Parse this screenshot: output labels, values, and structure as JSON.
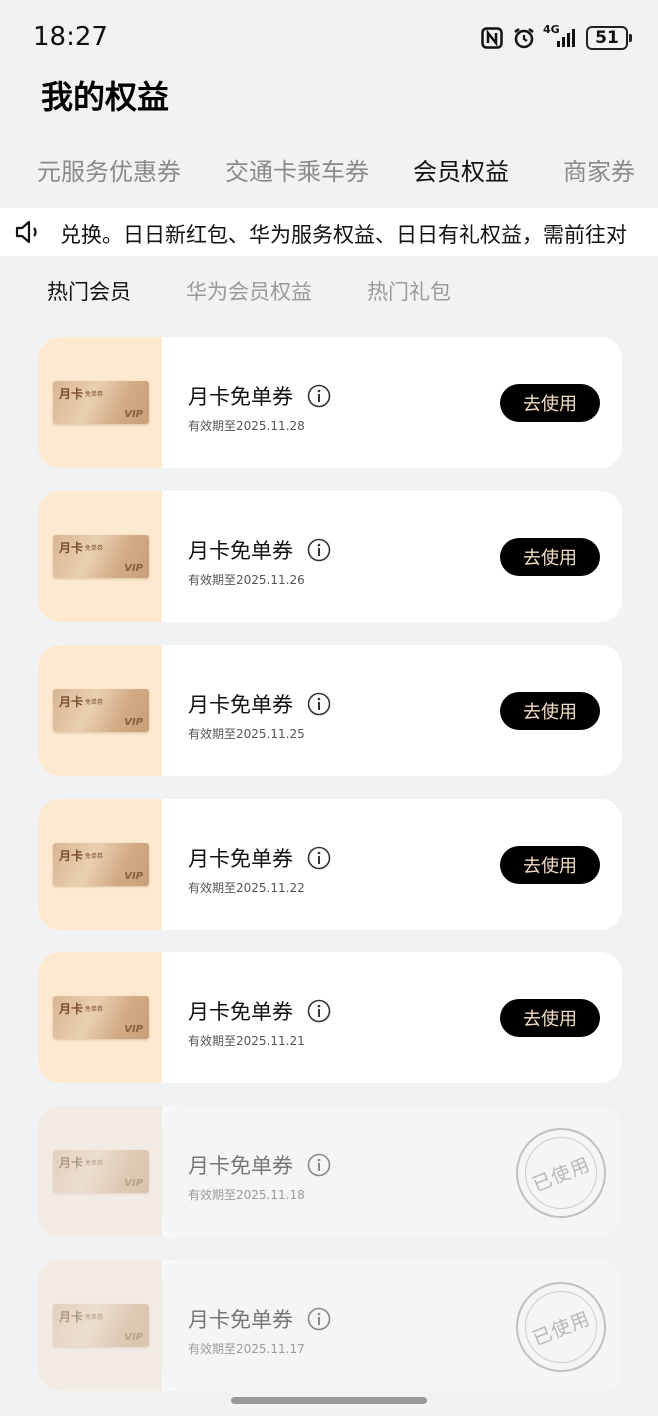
{
  "status_bar": {
    "time": "18:27",
    "network": "4G",
    "battery": "51"
  },
  "header": {
    "title": "我的权益"
  },
  "tabs": [
    {
      "label": "元服务优惠券",
      "active": false
    },
    {
      "label": "交通卡乘车券",
      "active": false
    },
    {
      "label": "会员权益",
      "active": true
    },
    {
      "label": "商家券",
      "active": false
    }
  ],
  "notice": {
    "text": "兑换。日日新红包、华为服务权益、日日有礼权益，需前往对"
  },
  "subtabs": [
    {
      "label": "热门会员",
      "active": true
    },
    {
      "label": "华为会员权益",
      "active": false
    },
    {
      "label": "热门礼包",
      "active": false
    }
  ],
  "coupon_art": {
    "label_main": "月卡",
    "label_sub": "免单券",
    "label_vip": "VIP"
  },
  "cards": [
    {
      "title": "月卡免单券",
      "expiry": "有效期至2025.11.28",
      "status": "available",
      "button": "去使用"
    },
    {
      "title": "月卡免单券",
      "expiry": "有效期至2025.11.26",
      "status": "available",
      "button": "去使用"
    },
    {
      "title": "月卡免单券",
      "expiry": "有效期至2025.11.25",
      "status": "available",
      "button": "去使用"
    },
    {
      "title": "月卡免单券",
      "expiry": "有效期至2025.11.22",
      "status": "available",
      "button": "去使用"
    },
    {
      "title": "月卡免单券",
      "expiry": "有效期至2025.11.21",
      "status": "available",
      "button": "去使用"
    },
    {
      "title": "月卡免单券",
      "expiry": "有效期至2025.11.18",
      "status": "used",
      "stamp": "已使用"
    },
    {
      "title": "月卡免单券",
      "expiry": "有效期至2025.11.17",
      "status": "used",
      "stamp": "已使用"
    }
  ],
  "colors": {
    "background": "#f1f2f4",
    "thumb_bg": "#fde9cf",
    "button_bg": "#000000",
    "button_text": "#f2dcc0"
  }
}
